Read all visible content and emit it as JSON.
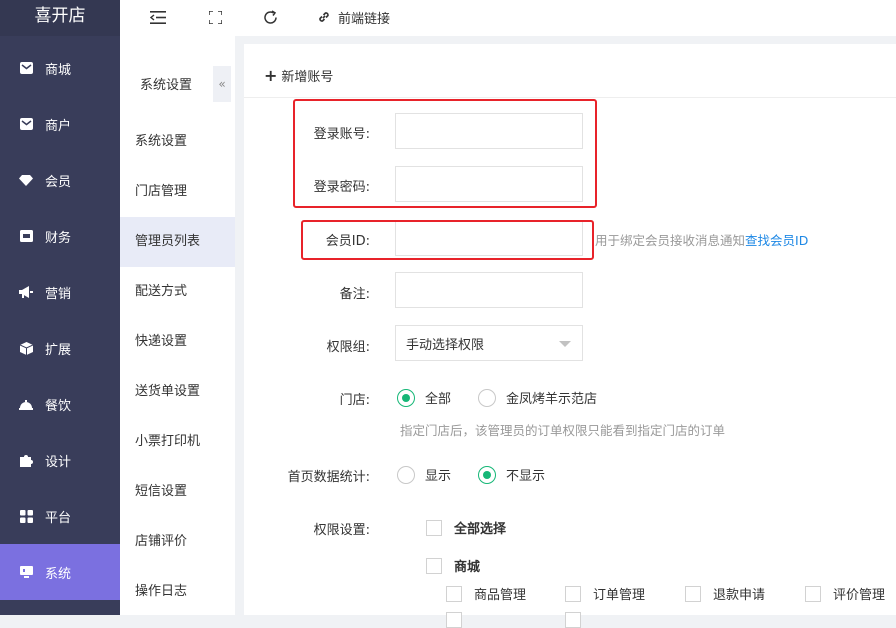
{
  "brand": "喜开店",
  "sidebar": {
    "items": [
      {
        "label": "商城",
        "icon": "mail-icon",
        "active": false
      },
      {
        "label": "商户",
        "icon": "mail-icon",
        "active": false
      },
      {
        "label": "会员",
        "icon": "gem-icon",
        "active": false
      },
      {
        "label": "财务",
        "icon": "wallet-icon",
        "active": false
      },
      {
        "label": "营销",
        "icon": "megaphone-icon",
        "active": false
      },
      {
        "label": "扩展",
        "icon": "cube-icon",
        "active": false
      },
      {
        "label": "餐饮",
        "icon": "cloche-icon",
        "active": false
      },
      {
        "label": "设计",
        "icon": "puzzle-icon",
        "active": false
      },
      {
        "label": "平台",
        "icon": "grid-icon",
        "active": false
      },
      {
        "label": "系统",
        "icon": "monitor-icon",
        "active": true
      }
    ]
  },
  "topbar": {
    "link_label": "前端链接"
  },
  "submenu": {
    "title": "系统设置",
    "collapse_glyph": "«",
    "items": [
      {
        "label": "系统设置"
      },
      {
        "label": "门店管理"
      },
      {
        "label": "管理员列表",
        "active": true
      },
      {
        "label": "配送方式"
      },
      {
        "label": "快递设置"
      },
      {
        "label": "送货单设置"
      },
      {
        "label": "小票打印机"
      },
      {
        "label": "短信设置"
      },
      {
        "label": "店铺评价"
      },
      {
        "label": "操作日志"
      }
    ]
  },
  "form": {
    "add_label": "新增账号",
    "username_label": "登录账号:",
    "password_label": "登录密码:",
    "member_id_label": "会员ID:",
    "member_id_hint": "用于绑定会员接收消息通知",
    "member_id_link": "查找会员ID",
    "remark_label": "备注:",
    "group_label": "权限组:",
    "group_value": "手动选择权限",
    "store_label": "门店:",
    "store_options": [
      "全部",
      "金凤烤羊示范店"
    ],
    "store_selected": "全部",
    "store_hint": "指定门店后，该管理员的订单权限只能看到指定门店的订单",
    "stats_label": "首页数据统计:",
    "stats_options": [
      "显示",
      "不显示"
    ],
    "stats_selected": "不显示",
    "perm_label": "权限设置:",
    "select_all": "全部选择",
    "perm_group": "商城",
    "perm_items": [
      "商品管理",
      "订单管理",
      "退款申请",
      "评价管理"
    ]
  },
  "colors": {
    "sidebar_bg": "#393d5a",
    "sidebar_active": "#7b70e0",
    "radio_green": "#16b777",
    "link_blue": "#1e88e5",
    "highlight_red": "#e8232a"
  }
}
